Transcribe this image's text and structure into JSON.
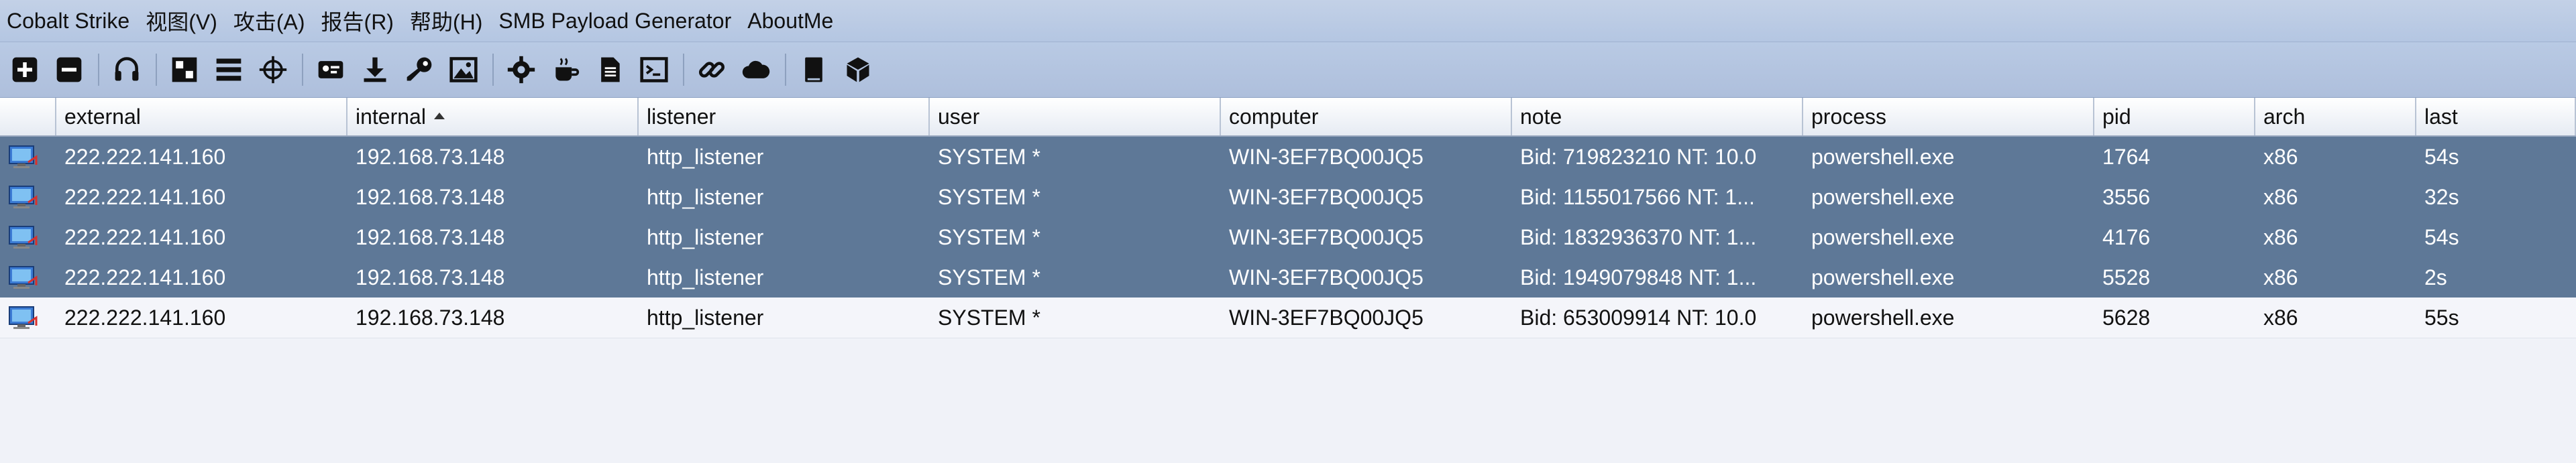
{
  "menu": [
    "Cobalt Strike",
    "视图(V)",
    "攻击(A)",
    "报告(R)",
    "帮助(H)",
    "SMB Payload Generator",
    "AboutMe"
  ],
  "toolbar_icons": [
    "new-connection-icon",
    "disconnect-icon",
    "headphones-icon",
    "pivot-graph-icon",
    "session-list-icon",
    "target-list-icon",
    "credentials-icon",
    "downloads-icon",
    "keystrokes-icon",
    "screenshots-icon",
    "payload-gen-icon",
    "java-applet-icon",
    "office-macro-icon",
    "script-console-icon",
    "link-icon",
    "cloud-icon",
    "log-icon",
    "package-icon"
  ],
  "columns": [
    {
      "key": "icon",
      "label": ""
    },
    {
      "key": "external",
      "label": "external"
    },
    {
      "key": "internal",
      "label": "internal",
      "sorted": true
    },
    {
      "key": "listener",
      "label": "listener"
    },
    {
      "key": "user",
      "label": "user"
    },
    {
      "key": "computer",
      "label": "computer"
    },
    {
      "key": "note",
      "label": "note"
    },
    {
      "key": "process",
      "label": "process"
    },
    {
      "key": "pid",
      "label": "pid"
    },
    {
      "key": "arch",
      "label": "arch"
    },
    {
      "key": "last",
      "label": "last"
    }
  ],
  "rows": [
    {
      "external": "222.222.141.160",
      "internal": "192.168.73.148",
      "listener": "http_listener",
      "user": "SYSTEM *",
      "computer": "WIN-3EF7BQ00JQ5",
      "note": "Bid: 719823210  NT: 10.0",
      "process": "powershell.exe",
      "pid": "1764",
      "arch": "x86",
      "last": "54s",
      "selected": true
    },
    {
      "external": "222.222.141.160",
      "internal": "192.168.73.148",
      "listener": "http_listener",
      "user": "SYSTEM *",
      "computer": "WIN-3EF7BQ00JQ5",
      "note": "Bid: 1155017566  NT: 1...",
      "process": "powershell.exe",
      "pid": "3556",
      "arch": "x86",
      "last": "32s",
      "selected": true
    },
    {
      "external": "222.222.141.160",
      "internal": "192.168.73.148",
      "listener": "http_listener",
      "user": "SYSTEM *",
      "computer": "WIN-3EF7BQ00JQ5",
      "note": "Bid: 1832936370  NT: 1...",
      "process": "powershell.exe",
      "pid": "4176",
      "arch": "x86",
      "last": "54s",
      "selected": true
    },
    {
      "external": "222.222.141.160",
      "internal": "192.168.73.148",
      "listener": "http_listener",
      "user": "SYSTEM *",
      "computer": "WIN-3EF7BQ00JQ5",
      "note": "Bid: 1949079848  NT: 1...",
      "process": "powershell.exe",
      "pid": "5528",
      "arch": "x86",
      "last": "2s",
      "selected": true
    },
    {
      "external": "222.222.141.160",
      "internal": "192.168.73.148",
      "listener": "http_listener",
      "user": "SYSTEM *",
      "computer": "WIN-3EF7BQ00JQ5",
      "note": "Bid: 653009914  NT: 10.0",
      "process": "powershell.exe",
      "pid": "5628",
      "arch": "x86",
      "last": "55s",
      "selected": false
    }
  ]
}
